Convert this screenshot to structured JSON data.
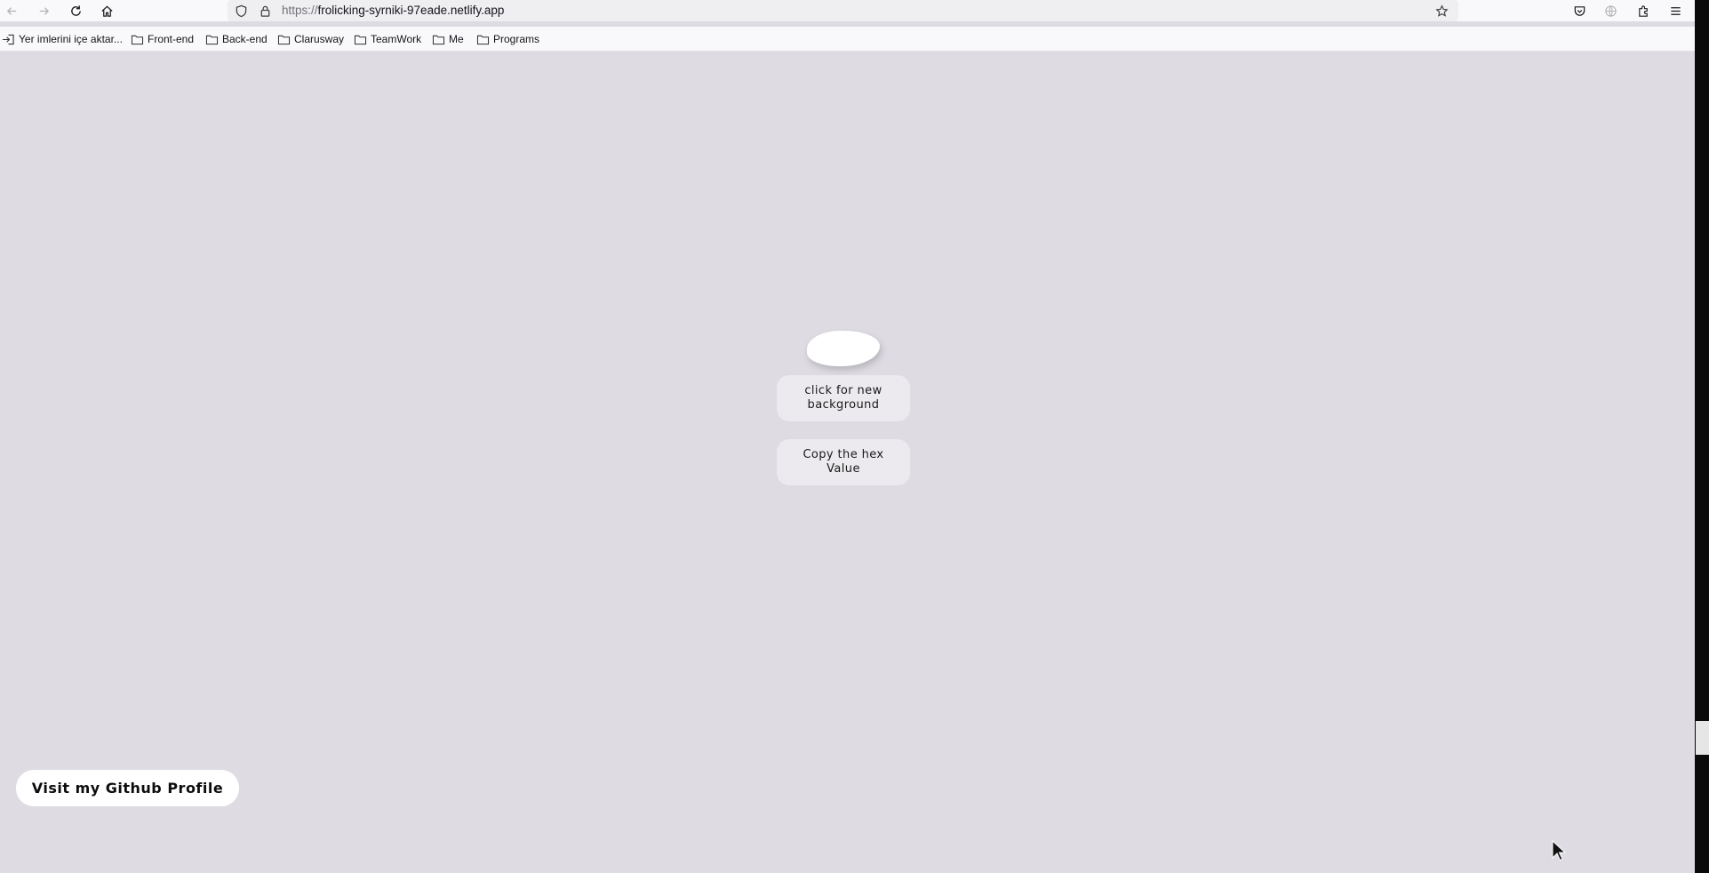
{
  "browser": {
    "url_protocol": "https://",
    "url_host": "frolicking-syrniki-97eade.netlify.app",
    "bookmarks": [
      {
        "label": "Yer imlerini içe aktar...",
        "icon": "import-icon"
      },
      {
        "label": "Front-end",
        "icon": "folder-icon"
      },
      {
        "label": "Back-end",
        "icon": "folder-icon"
      },
      {
        "label": "Clarusway",
        "icon": "folder-icon"
      },
      {
        "label": "TeamWork",
        "icon": "folder-icon"
      },
      {
        "label": "Me",
        "icon": "folder-icon"
      },
      {
        "label": "Programs",
        "icon": "folder-icon"
      }
    ]
  },
  "page": {
    "background_color": "#dedbe3",
    "new_background_label": "click for new background",
    "copy_hex_label": "Copy the hex Value",
    "github_label": "Visit my Github Profile"
  }
}
